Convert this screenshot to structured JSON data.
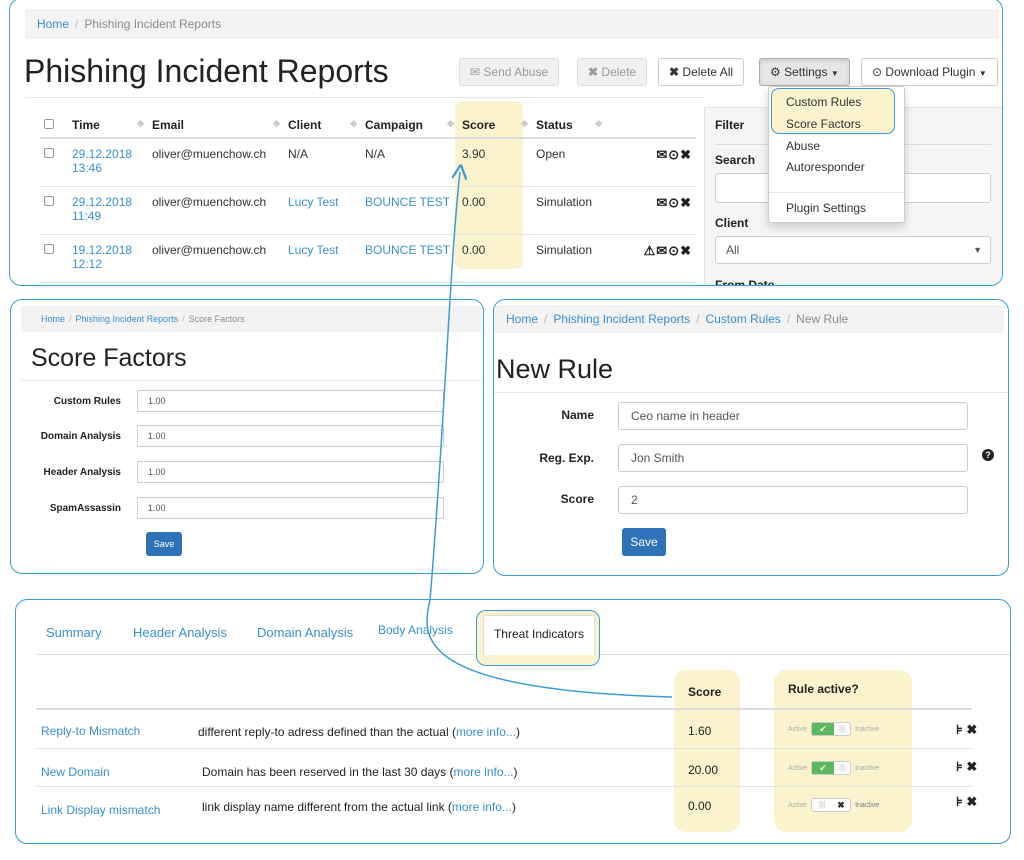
{
  "reports": {
    "breadcrumb": [
      "Home",
      "Phishing Incident Reports"
    ],
    "title": "Phishing Incident Reports",
    "buttons": {
      "send_abuse": "Send Abuse",
      "delete": "Delete",
      "delete_all": "Delete All",
      "settings": "Settings",
      "download_plugin": "Download Plugin"
    },
    "columns": [
      "Time",
      "Email",
      "Client",
      "Campaign",
      "Score",
      "Status"
    ],
    "rows": [
      {
        "time": "29.12.2018 13:46",
        "email": "oliver@muenchow.ch",
        "client": "N/A",
        "campaign": "N/A",
        "score": "3.90",
        "status": "Open",
        "actions": "✉⊙✖"
      },
      {
        "time": "29.12.2018 11:49",
        "email": "oliver@muenchow.ch",
        "client": "Lucy Test",
        "campaign": "BOUNCE TEST",
        "score": "0.00",
        "status": "Simulation",
        "actions": "✉⊙✖"
      },
      {
        "time": "19.12.2018 12:12",
        "email": "oliver@muenchow.ch",
        "client": "Lucy Test",
        "campaign": "BOUNCE TEST",
        "score": "0.00",
        "status": "Simulation",
        "actions": "⚠✉⊙✖"
      }
    ],
    "filter": {
      "title": "Filter",
      "search_label": "Search",
      "client_label": "Client",
      "client_value": "All",
      "from_date_label": "From Date"
    },
    "settings_menu": [
      "Custom Rules",
      "Score Factors",
      "Abuse",
      "Autoresponder",
      "Plugin Settings"
    ]
  },
  "score_factors": {
    "breadcrumb": [
      "Home",
      "Phishing Incident Reports",
      "Score Factors"
    ],
    "title": "Score Factors",
    "fields": [
      {
        "label": "Custom Rules",
        "value": "1.00"
      },
      {
        "label": "Domain Analysis",
        "value": "1.00"
      },
      {
        "label": "Header Analysis",
        "value": "1.00"
      },
      {
        "label": "SpamAssassin",
        "value": "1.00"
      }
    ],
    "save": "Save"
  },
  "new_rule": {
    "breadcrumb": [
      "Home",
      "Phishing Incident Reports",
      "Custom Rules",
      "New Rule"
    ],
    "title": "New Rule",
    "fields": [
      {
        "label": "Name",
        "value": "Ceo name in header"
      },
      {
        "label": "Reg. Exp.",
        "value": "Jon Smith"
      },
      {
        "label": "Score",
        "value": "2"
      }
    ],
    "help_icon": "question-circle-icon",
    "save": "Save"
  },
  "threats": {
    "tabs": [
      "Summary",
      "Header Analysis",
      "Domain Analysis",
      "Body Analysis",
      "Threat Indicators"
    ],
    "active_tab": "Threat Indicators",
    "columns": {
      "score": "Score",
      "rule_active": "Rule active?"
    },
    "toggle_labels": {
      "active": "Active",
      "inactive": "Inactive"
    },
    "rows": [
      {
        "name": "Reply-to Mismatch",
        "desc": "different reply-to adress defined than the actual (",
        "more": "more info...",
        "close": ")",
        "score": "1.60",
        "active": true
      },
      {
        "name": "New Domain",
        "desc": "Domain has been reserved in the last 30 days   (",
        "more": "more info...",
        "close": ")",
        "score": "20.00",
        "active": true
      },
      {
        "name": "Link Display mismatch",
        "desc": "link display name different from the actual link (",
        "more": "more info...",
        "close": ")",
        "score": "0.00",
        "active": false
      }
    ]
  },
  "colors": {
    "accent": "#3a9bd5",
    "highlight": "#fbf3cd",
    "link": "#3a8fd0",
    "primary_button": "#2e73b8",
    "toggle_on": "#5cb85c"
  }
}
